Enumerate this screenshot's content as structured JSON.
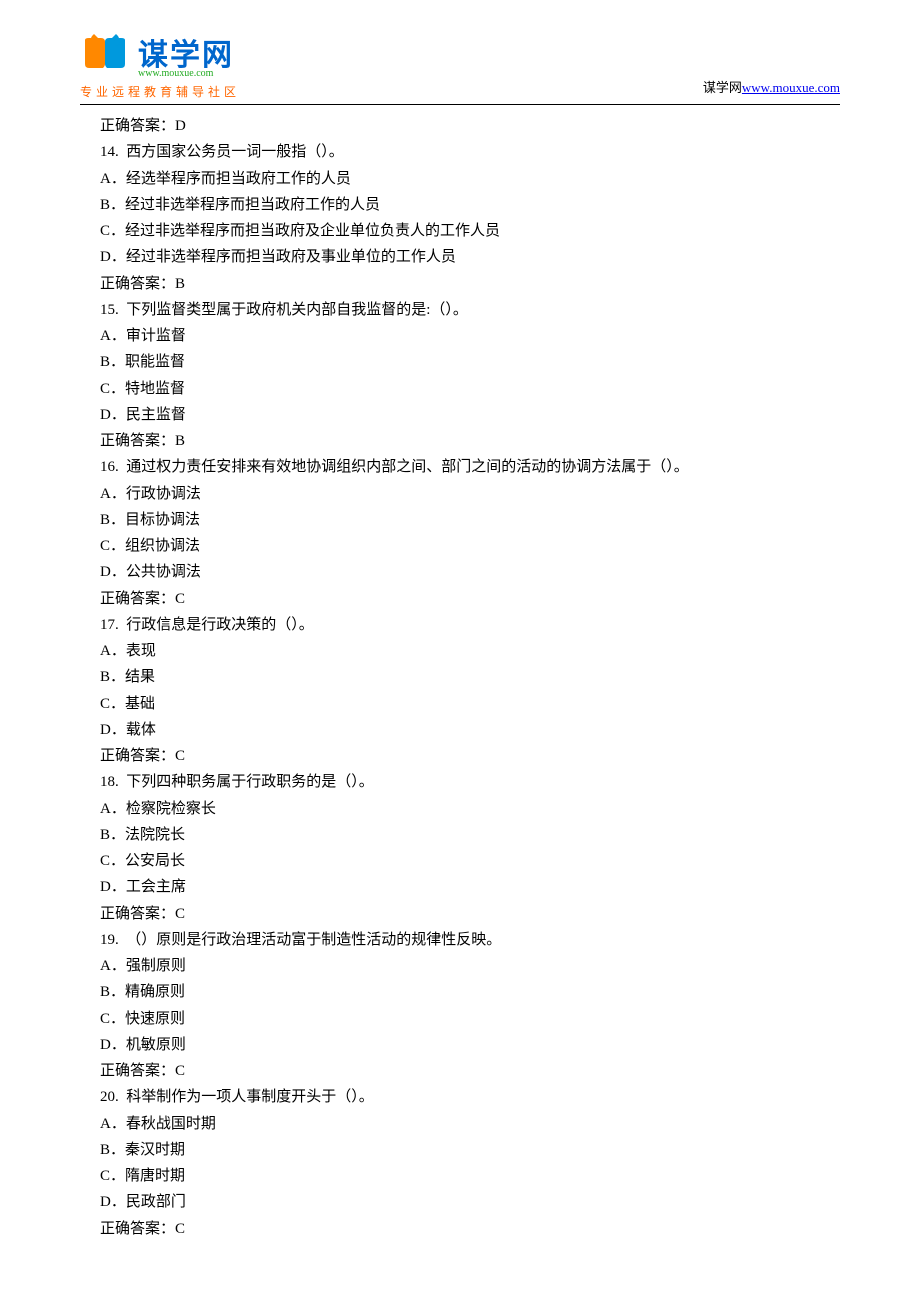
{
  "header": {
    "logo_text": "谋学网",
    "logo_url": "www.mouxue.com",
    "logo_tagline": "专业远程教育辅导社区",
    "right_prefix": "谋学网",
    "right_link": "www.mouxue.com"
  },
  "lines": [
    "正确答案：D",
    "14.  西方国家公务员一词一般指（）。",
    "A．经选举程序而担当政府工作的人员",
    "B．经过非选举程序而担当政府工作的人员",
    "C．经过非选举程序而担当政府及企业单位负责人的工作人员",
    "D．经过非选举程序而担当政府及事业单位的工作人员",
    "正确答案：B",
    "15.  下列监督类型属于政府机关内部自我监督的是:（）。",
    "A．审计监督",
    "B．职能监督",
    "C．特地监督",
    "D．民主监督",
    "正确答案：B",
    "16.  通过权力责任安排来有效地协调组织内部之间、部门之间的活动的协调方法属于（）。",
    "A．行政协调法",
    "B．目标协调法",
    "C．组织协调法",
    "D．公共协调法",
    "正确答案：C",
    "17.  行政信息是行政决策的（）。",
    "A．表现",
    "B．结果",
    "C．基础",
    "D．载体",
    "正确答案：C",
    "18.  下列四种职务属于行政职务的是（）。",
    "A．检察院检察长",
    "B．法院院长",
    "C．公安局长",
    "D．工会主席",
    "正确答案：C",
    "19.  （）原则是行政治理活动富于制造性活动的规律性反映。",
    "A．强制原则",
    "B．精确原则",
    "C．快速原则",
    "D．机敏原则",
    "正确答案：C",
    "20.  科举制作为一项人事制度开头于（）。",
    "A．春秋战国时期",
    "B．秦汉时期",
    "C．隋唐时期",
    "D．民政部门",
    "正确答案：C"
  ]
}
